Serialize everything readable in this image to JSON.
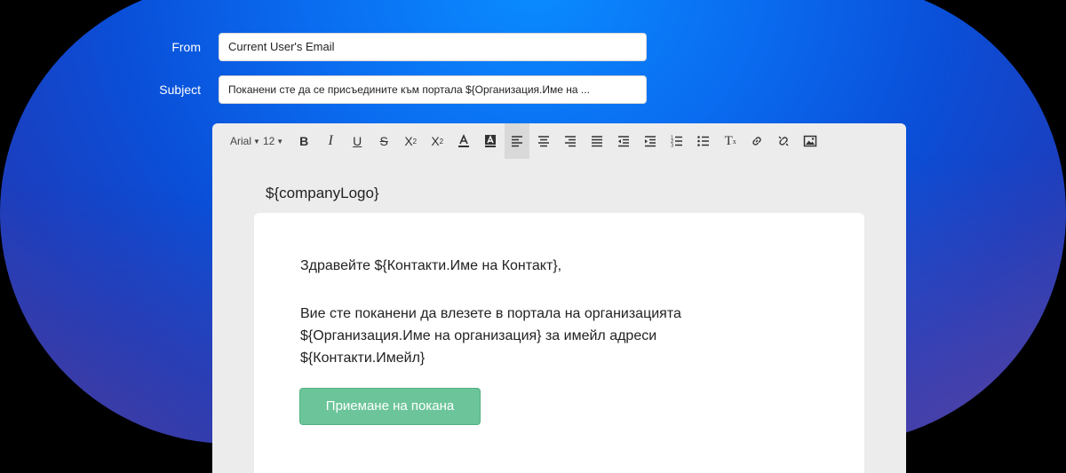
{
  "form": {
    "from_label": "From",
    "from_value": "Current User's Email",
    "subject_label": "Subject",
    "subject_value": "Поканени сте да се присъедините към портала ${Организация.Име на ..."
  },
  "toolbar": {
    "font_family": "Arial",
    "font_size": "12",
    "buttons": [
      "bold-icon",
      "italic-icon",
      "underline-icon",
      "strikethrough-icon",
      "subscript-icon",
      "superscript-icon",
      "font-color-icon",
      "background-color-icon",
      "align-left-icon",
      "align-center-icon",
      "align-right-icon",
      "align-justify-icon",
      "outdent-icon",
      "indent-icon",
      "ordered-list-icon",
      "unordered-list-icon",
      "clear-format-icon",
      "link-icon",
      "unlink-icon",
      "image-icon"
    ],
    "active_button": "align-left-icon"
  },
  "email": {
    "logo_placeholder": "${companyLogo}",
    "greeting": "Здравейте ${Контакти.Име на Контакт},",
    "body_line1": "Вие сте поканени да влезете в портала на организацията",
    "body_line2": "${Организация.Име на организация} за имейл адреси",
    "body_line3": "${Контакти.Имейл}",
    "accept_button": "Приемане на покана"
  },
  "colors": {
    "accent_button": "#6cc59a",
    "backdrop": "#0a6cf0"
  }
}
